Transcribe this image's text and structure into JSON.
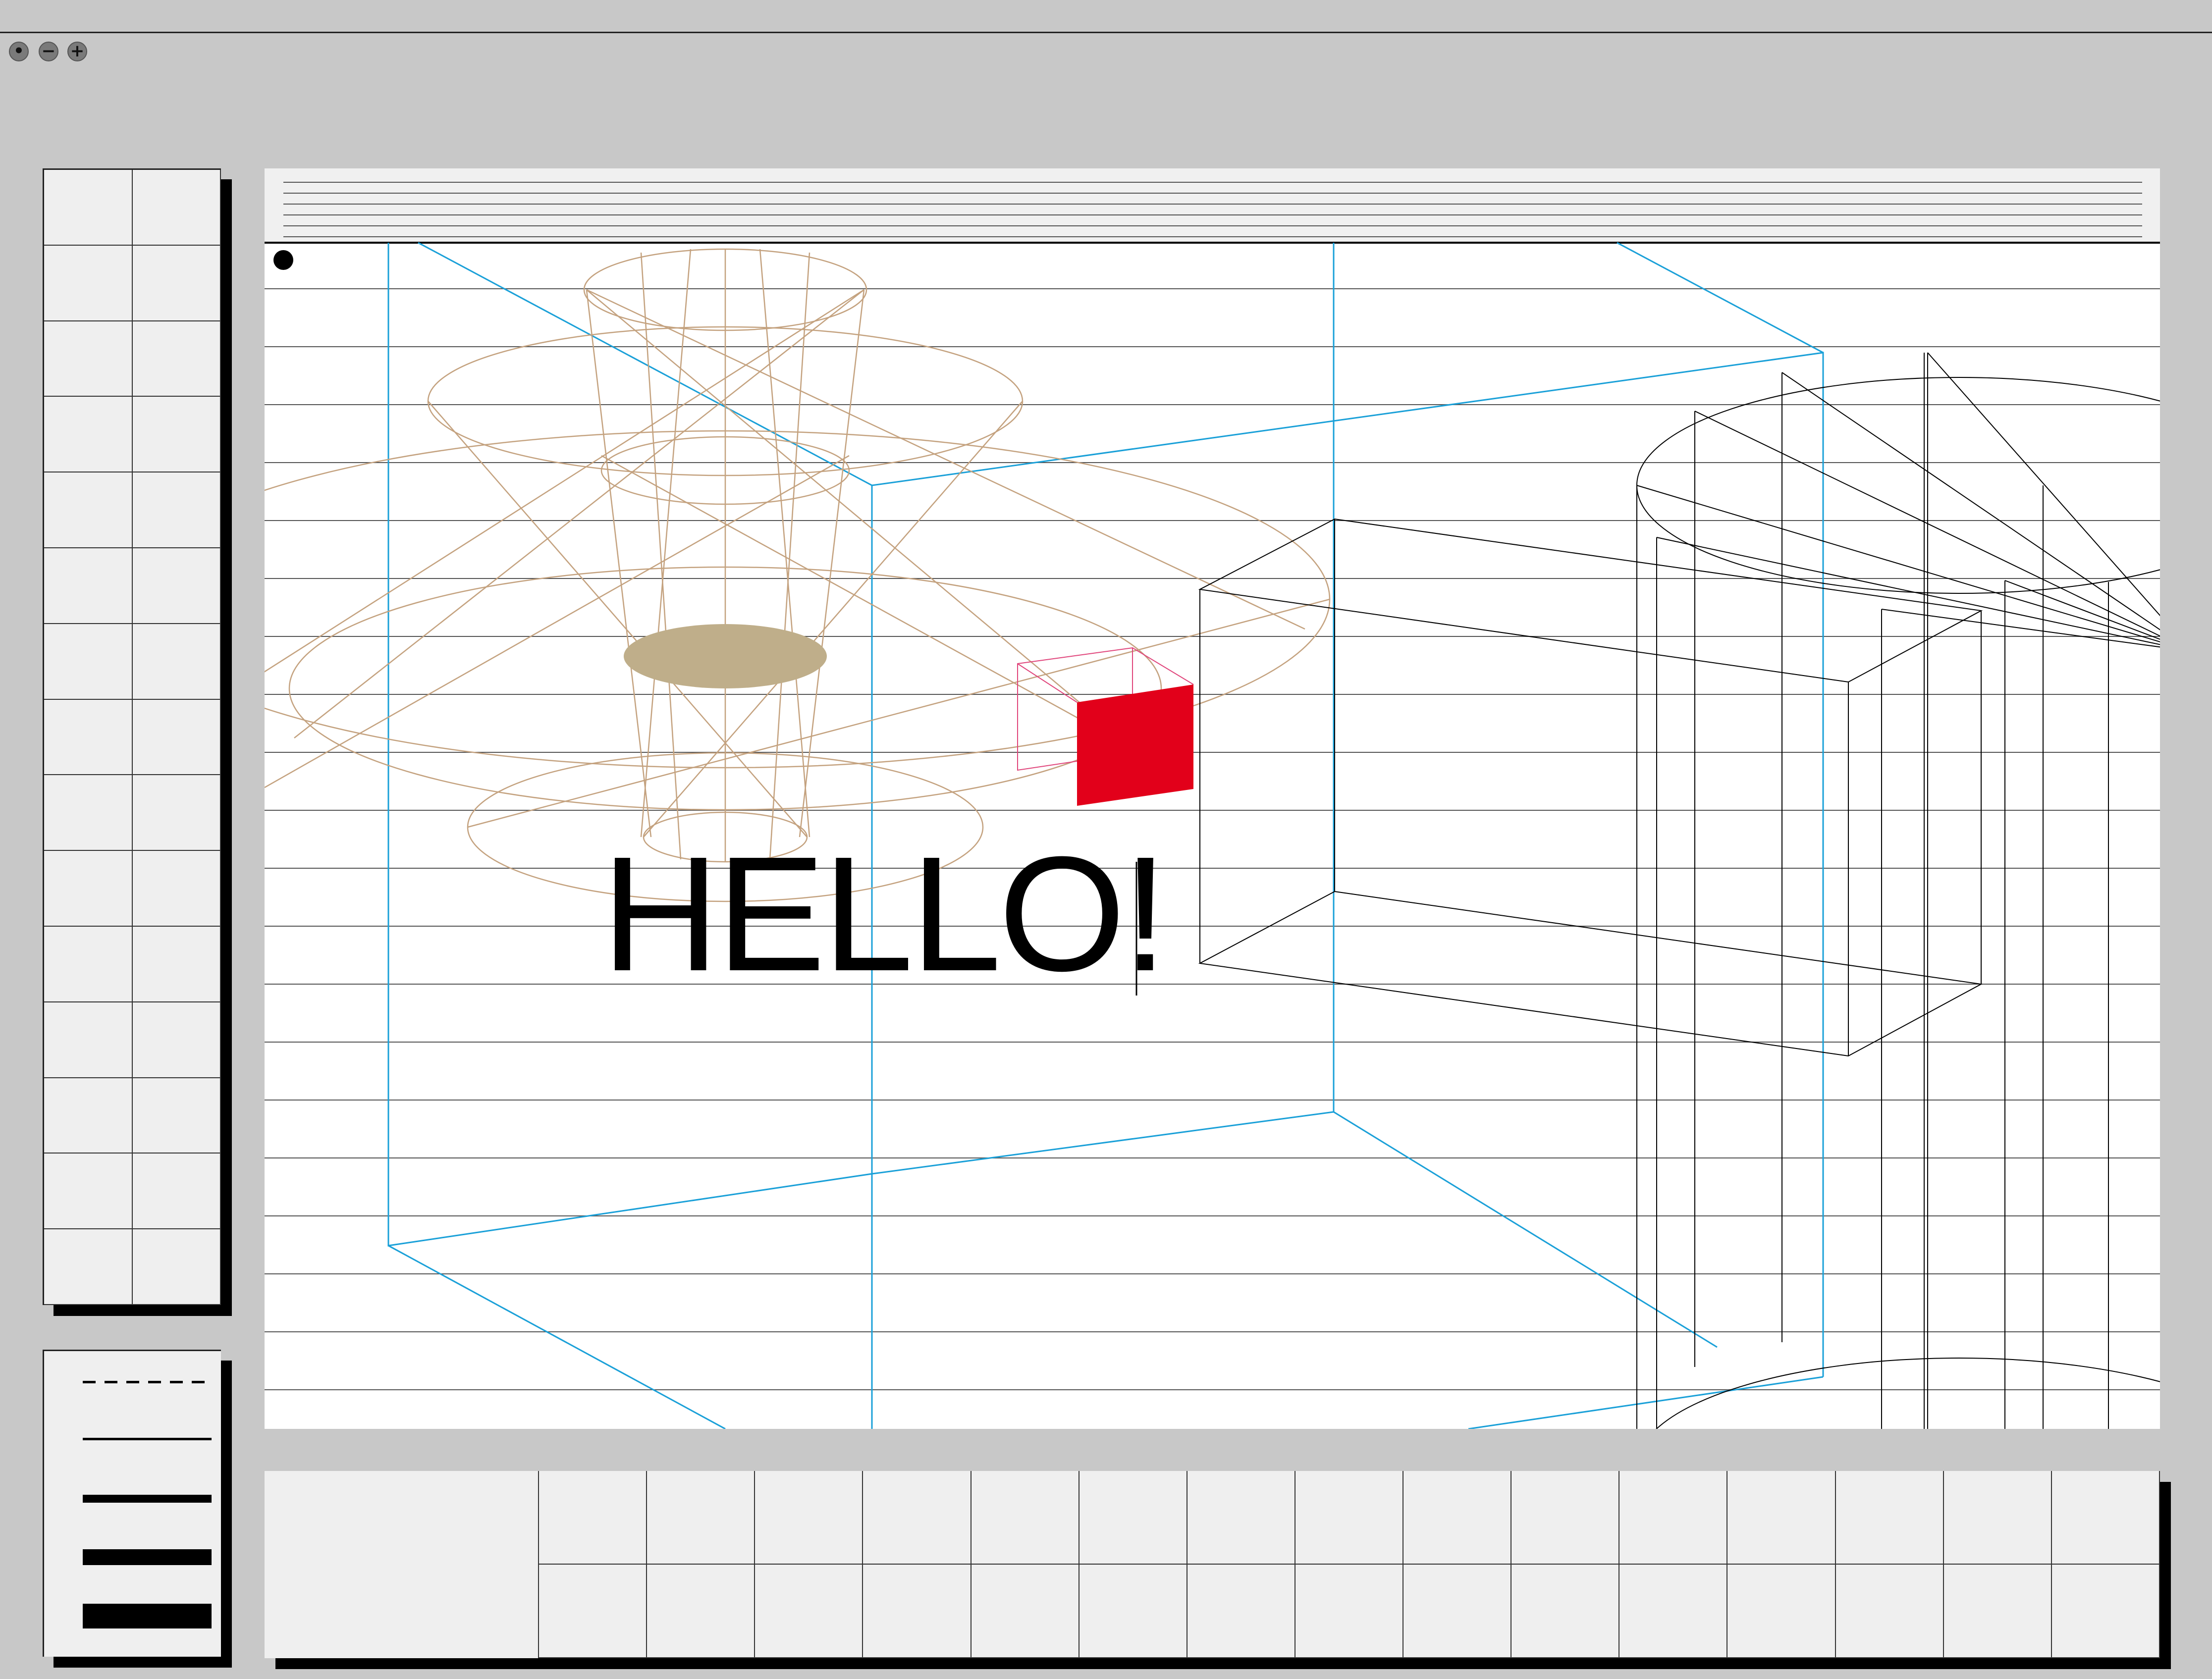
{
  "window": {
    "controls": [
      {
        "name": "close-dot",
        "glyph": "•"
      },
      {
        "name": "minimize",
        "glyph": "−"
      },
      {
        "name": "maximize",
        "glyph": "+"
      }
    ]
  },
  "canvas": {
    "text": "HELLO!",
    "colors": {
      "blue_box": "#1aa0d8",
      "lamp": "#c4a27f",
      "lamp_fill": "#bfae8a",
      "accent_red": "#e2001a",
      "pink_outline": "#e0457b",
      "black_lines": "#000000",
      "ruling": "#444444"
    }
  },
  "palette": {
    "rows": 15,
    "columns": 2
  },
  "stroke_widths": [
    "dashed",
    "thin",
    "medium",
    "thick",
    "heavy"
  ],
  "timeline": {
    "columns": 15,
    "rows": 2
  }
}
